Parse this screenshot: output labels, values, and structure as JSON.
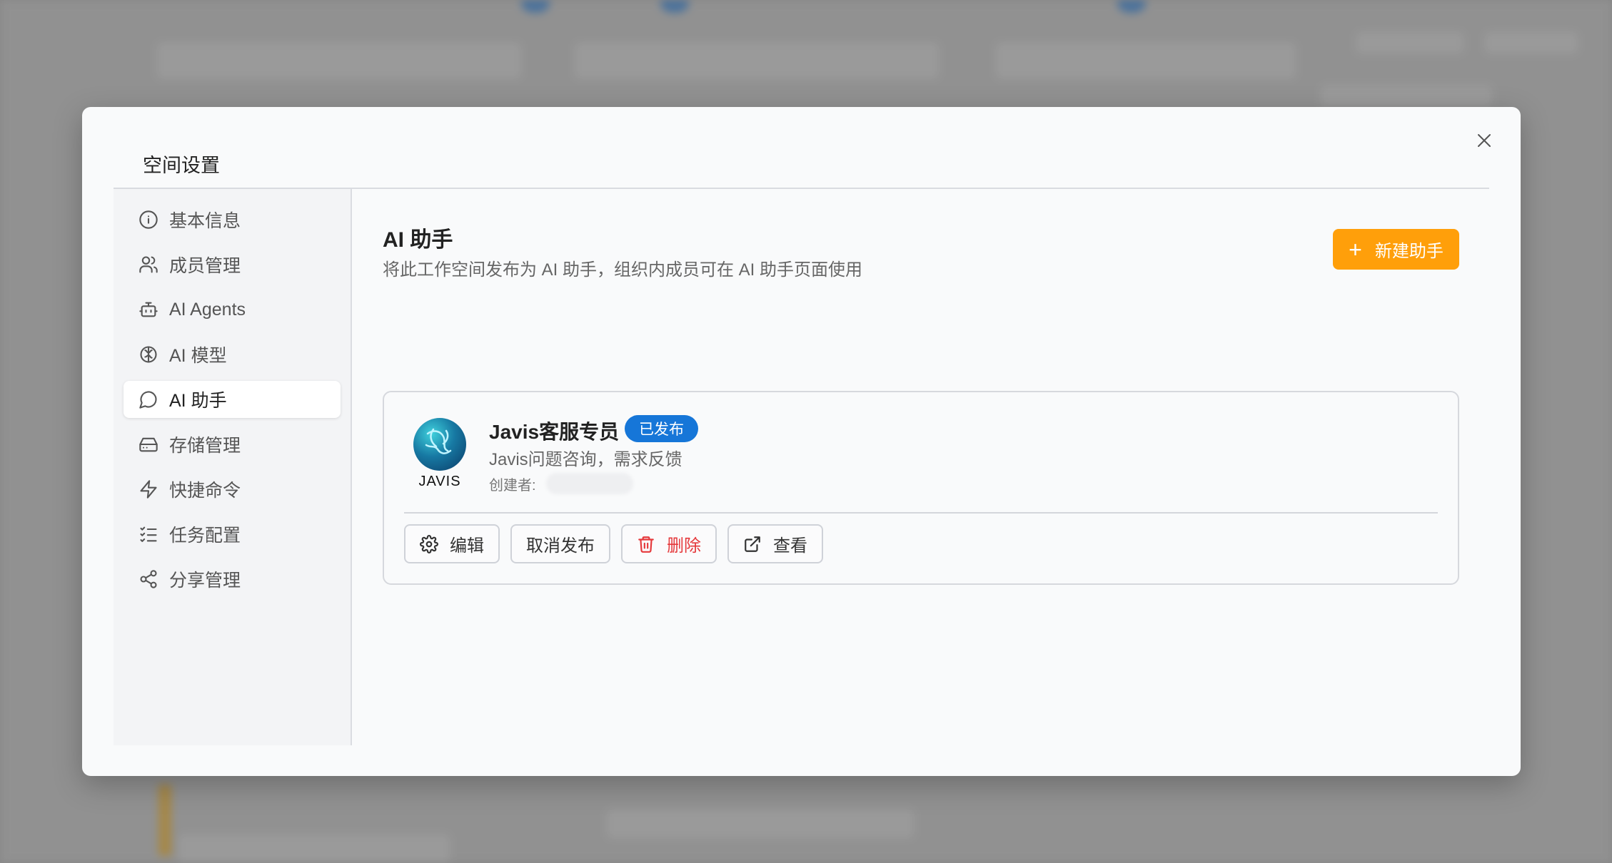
{
  "modal": {
    "title": "空间设置"
  },
  "sidebar": {
    "items": [
      {
        "label": "基本信息",
        "icon": "info-icon"
      },
      {
        "label": "成员管理",
        "icon": "users-icon"
      },
      {
        "label": "AI Agents",
        "icon": "bot-icon"
      },
      {
        "label": "AI 模型",
        "icon": "brain-icon"
      },
      {
        "label": "AI 助手",
        "icon": "message-circle-icon",
        "active": true
      },
      {
        "label": "存储管理",
        "icon": "hard-drive-icon"
      },
      {
        "label": "快捷命令",
        "icon": "zap-icon"
      },
      {
        "label": "任务配置",
        "icon": "list-checks-icon"
      },
      {
        "label": "分享管理",
        "icon": "share-icon"
      }
    ]
  },
  "main": {
    "title": "AI 助手",
    "description": "将此工作空间发布为 AI 助手，组织内成员可在 AI 助手页面使用",
    "new_button": "新建助手"
  },
  "assistant": {
    "logo_text": "JAVIS",
    "name": "Javis客服专员",
    "status": "已发布",
    "description": "Javis问题咨询，需求反馈",
    "creator_label": "创建者:",
    "actions": {
      "edit": "编辑",
      "unpublish": "取消发布",
      "delete": "删除",
      "view": "查看"
    }
  },
  "colors": {
    "accent": "#ff9f0a",
    "badge": "#1676d8",
    "danger": "#e5383b"
  }
}
